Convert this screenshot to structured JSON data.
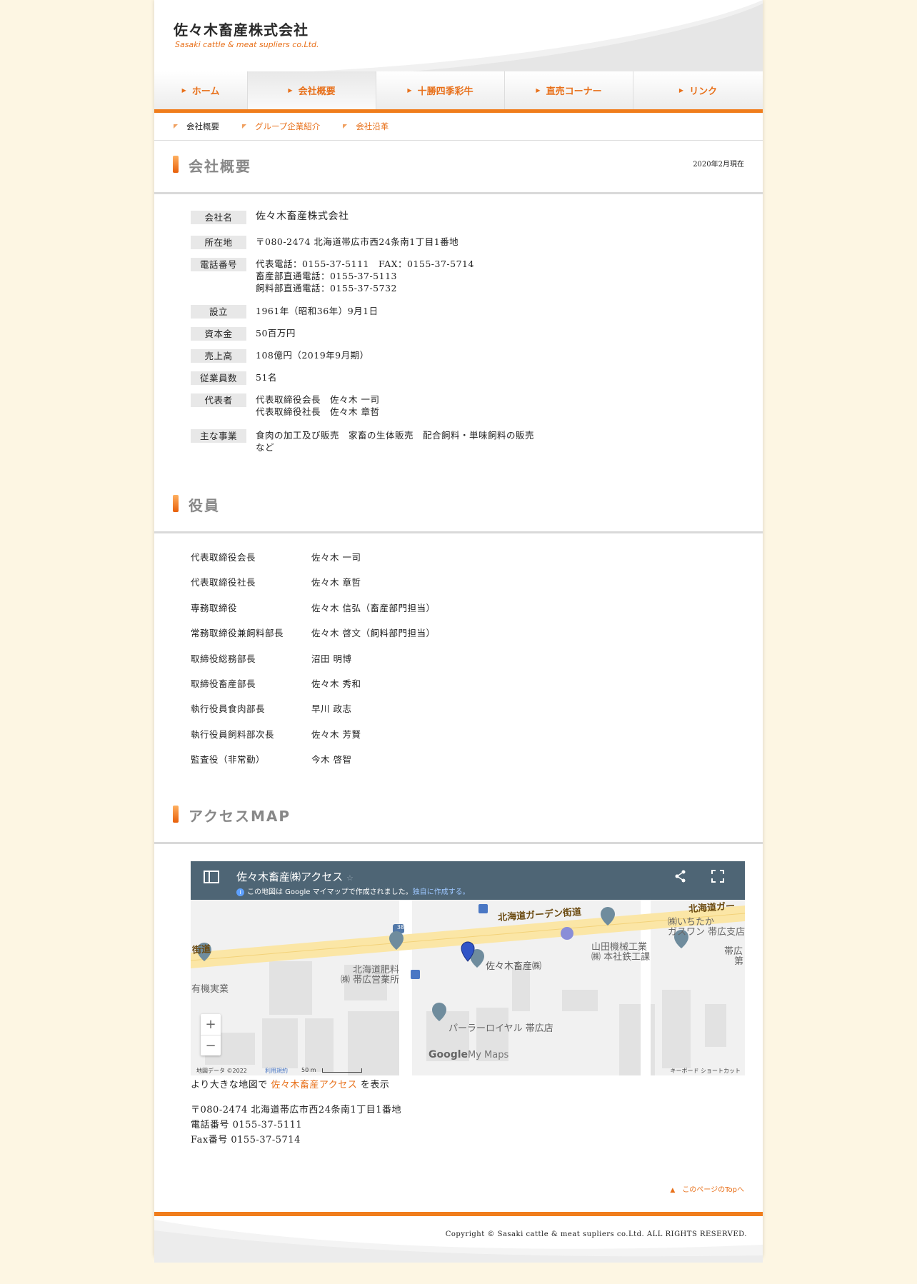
{
  "header": {
    "logo_jp": "佐々木畜産株式会社",
    "logo_en": "Sasaki cattle & meat supliers co.Ltd."
  },
  "nav": {
    "items": [
      {
        "label": "ホーム"
      },
      {
        "label": "会社概要"
      },
      {
        "label": "十勝四季彩牛"
      },
      {
        "label": "直売コーナー"
      },
      {
        "label": "リンク"
      }
    ]
  },
  "subnav": {
    "items": [
      {
        "label": "会社概要"
      },
      {
        "label": "グループ企業紹介"
      },
      {
        "label": "会社沿革"
      }
    ]
  },
  "overview": {
    "title": "会社概要",
    "date": "2020年2月現在",
    "rows": [
      {
        "label": "会社名",
        "value": "佐々木畜産株式会社"
      },
      {
        "label": "所在地",
        "value": "〒080-2474 北海道帯広市西24条南1丁目1番地"
      },
      {
        "label": "電話番号",
        "lines": [
          "代表電話：0155-37-5111　FAX：0155-37-5714",
          "畜産部直通電話：0155-37-5113",
          "飼料部直通電話：0155-37-5732"
        ]
      },
      {
        "label": "設立",
        "value": "1961年（昭和36年）9月1日"
      },
      {
        "label": "資本金",
        "value": "50百万円"
      },
      {
        "label": "売上高",
        "value": "108億円（2019年9月期）"
      },
      {
        "label": "従業員数",
        "value": "51名"
      },
      {
        "label": "代表者",
        "lines": [
          "代表取締役会長　佐々木 一司",
          "代表取締役社長　佐々木 章哲"
        ]
      },
      {
        "label": "主な事業",
        "lines": [
          "食肉の加工及び販売　家畜の生体販売　配合飼料・単味飼料の販売",
          "など"
        ]
      }
    ]
  },
  "officers": {
    "title": "役員",
    "rows": [
      {
        "role": "代表取締役会長",
        "name": "佐々木 一司"
      },
      {
        "role": "代表取締役社長",
        "name": "佐々木 章哲"
      },
      {
        "role": "専務取締役",
        "name": "佐々木 信弘（畜産部門担当）"
      },
      {
        "role": "常務取締役兼飼料部長",
        "name": "佐々木 啓文（飼料部門担当）"
      },
      {
        "role": "取締役総務部長",
        "name": "沼田 明博"
      },
      {
        "role": "取締役畜産部長",
        "name": "佐々木 秀和"
      },
      {
        "role": "執行役員食肉部長",
        "name": "早川 政志"
      },
      {
        "role": "執行役員飼料部次長",
        "name": "佐々木 芳賢"
      },
      {
        "role": "監査役（非常勤）",
        "name": "今木 啓智"
      }
    ]
  },
  "access": {
    "title": "アクセスMAP",
    "map": {
      "title": "佐々木畜産㈱アクセス",
      "note": "この地図は Google マイマップで作成されました。",
      "note_link": "独自に作成する。",
      "labels": {
        "road_main": "北海道ガーデン街道",
        "road_right": "北海道ガー",
        "road_left": "街道",
        "route_num": "38",
        "company": "佐々木畜産㈱",
        "hiryo_1": "北海道肥料",
        "hiryo_2": "㈱ 帯広営業所",
        "yamada_1": "山田機械工業",
        "yamada_2": "㈱ 本社鉄工課",
        "ichitaka_1": "㈱いちたか",
        "ichitaka_2": "ガスワン 帯広支店",
        "obihiro_1": "帯広",
        "obihiro_2": "第",
        "yuki": "有機実業",
        "parlor": "パーラーロイヤル 帯広店",
        "google": "Google",
        "mymaps": "My Maps"
      },
      "zoom_in": "+",
      "zoom_out": "−",
      "footer_data": "地図データ ©2022",
      "footer_terms": "利用規約",
      "footer_scale": "50 m",
      "footer_shortcut": "キーボード ショートカット"
    },
    "larger_prefix": "より大きな地図で",
    "larger_link": "佐々木畜産アクセス",
    "larger_suffix": "を表示",
    "address": "〒080-2474 北海道帯広市西24条南1丁目1番地",
    "phone": "電話番号 0155-37-5111",
    "fax": "Fax番号 0155-37-5714"
  },
  "totop": "このページのTopへ",
  "footer": {
    "copyright": "Copyright © Sasaki cattle & meat supliers co.Ltd. ALL RIGHTS RESERVED."
  },
  "colors": {
    "accent": "#f07d1c",
    "accent_text": "#e8701a",
    "page_bg": "#fdf6e3",
    "map_topbar": "#4e6575"
  }
}
